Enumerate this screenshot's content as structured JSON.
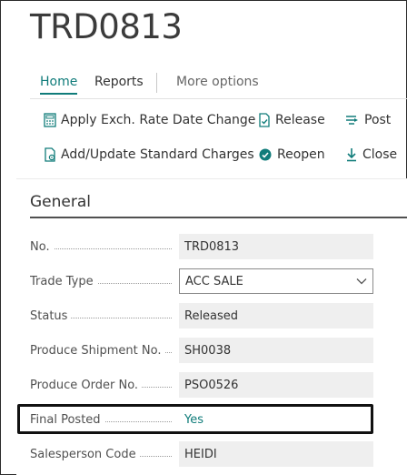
{
  "page": {
    "title": "TRD0813"
  },
  "tabs": [
    {
      "label": "Home"
    },
    {
      "label": "Reports"
    },
    {
      "label": "More options"
    }
  ],
  "actions": {
    "apply_exch": "Apply Exch. Rate Date Change",
    "release": "Release",
    "post": "Post",
    "add_update": "Add/Update Standard Charges",
    "reopen": "Reopen",
    "close": "Close"
  },
  "section": {
    "title": "General"
  },
  "fields": [
    {
      "label": "No.",
      "value": "TRD0813"
    },
    {
      "label": "Trade Type",
      "value": "ACC SALE"
    },
    {
      "label": "Status",
      "value": "Released"
    },
    {
      "label": "Produce Shipment No.",
      "value": "SH0038"
    },
    {
      "label": "Produce Order No.",
      "value": "PSO0526"
    },
    {
      "label": "Final Posted",
      "value": "Yes"
    },
    {
      "label": "Salesperson Code",
      "value": "HEIDI"
    }
  ],
  "colors": {
    "accent": "#107c7a",
    "text": "#333333",
    "field_bg": "#efefef"
  }
}
